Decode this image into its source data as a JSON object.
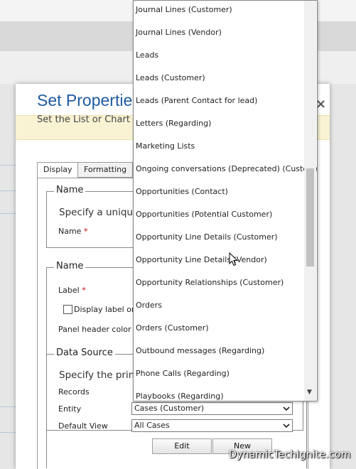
{
  "dialog": {
    "title": "Set Properties",
    "subtitle": "Set the List or Chart p",
    "close_glyph": "×"
  },
  "tabs": [
    {
      "label": "Display",
      "active": true
    },
    {
      "label": "Formatting",
      "active": false
    }
  ],
  "name_group": {
    "legend": "Name",
    "instruction": "Specify a unique",
    "name_label": "Name",
    "required_mark": "*"
  },
  "label_group": {
    "legend": "Name",
    "label_label": "Label",
    "required_mark": "*",
    "display_label_checkbox": "Display label on f",
    "panel_header_color": "Panel header color"
  },
  "data_source": {
    "legend": "Data Source",
    "instruction": "Specify the prima",
    "records_label": "Records",
    "entity_label": "Entity",
    "entity_value": "Cases (Customer)",
    "default_view_label": "Default View",
    "default_view_value": "All Cases",
    "edit_button": "Edit",
    "new_button": "New"
  },
  "dropdown": {
    "items": [
      "Journal Lines (Customer)",
      "Journal Lines (Vendor)",
      "Leads",
      "Leads (Customer)",
      "Leads (Parent Contact for lead)",
      "Letters (Regarding)",
      "Marketing Lists",
      "Ongoing conversations (Deprecated) (Customer)",
      "Opportunities (Contact)",
      "Opportunities (Potential Customer)",
      "Opportunity Line Details (Customer)",
      "Opportunity Line Details (Vendor)",
      "Opportunity Relationships (Customer)",
      "Orders",
      "Orders (Customer)",
      "Outbound messages (Regarding)",
      "Phone Calls (Regarding)",
      "Playbooks (Regarding)"
    ],
    "scroll_arrow": "▼"
  },
  "watermark": "DynamicTechIgnite.com",
  "colors": {
    "title_blue": "#1e5aa0",
    "required_red": "#cc0000",
    "notice_yellow": "#f9f3d4"
  }
}
